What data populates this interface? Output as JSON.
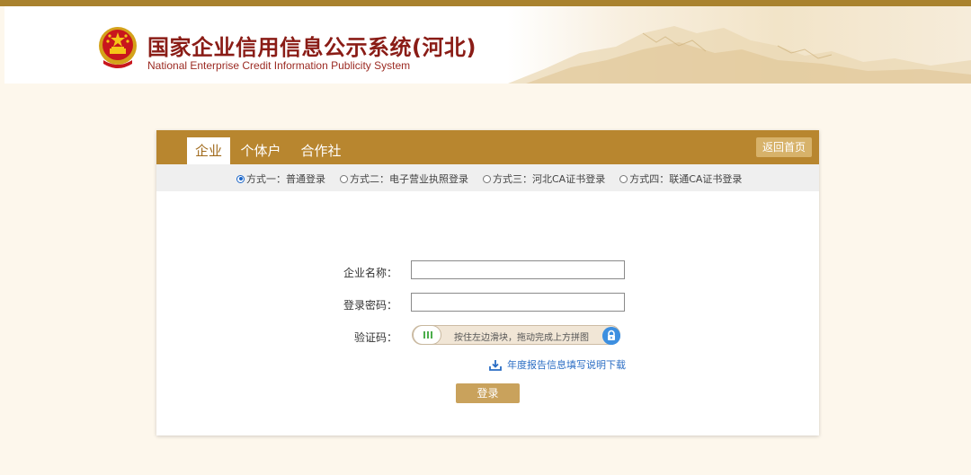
{
  "header": {
    "title": "国家企业信用信息公示系统(河北)",
    "subtitle": "National Enterprise Credit Information Publicity System"
  },
  "tabs": [
    {
      "label": "企业",
      "active": true
    },
    {
      "label": "个体户",
      "active": false
    },
    {
      "label": "合作社",
      "active": false
    }
  ],
  "home_button": "返回首页",
  "login_methods": [
    {
      "label": "方式一：普通登录",
      "selected": true
    },
    {
      "label": "方式二：电子营业执照登录",
      "selected": false
    },
    {
      "label": "方式三：河北CA证书登录",
      "selected": false
    },
    {
      "label": "方式四：联通CA证书登录",
      "selected": false
    }
  ],
  "form": {
    "company_name_label": "企业名称：",
    "company_name_value": "",
    "password_label": "登录密码：",
    "password_value": "",
    "captcha_label": "验证码：",
    "slider_hint": "按住左边滑块，拖动完成上方拼图",
    "download_link": "年度报告信息填写说明下载",
    "login_button": "登录"
  },
  "colors": {
    "accent": "#b8862f",
    "title_red": "#8a1c16",
    "link_blue": "#2a6dc4",
    "button": "#c9a25c"
  }
}
